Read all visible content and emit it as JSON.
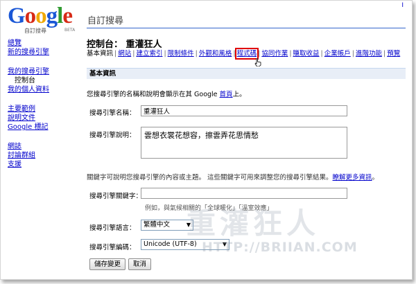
{
  "header": {
    "logo_parts": [
      "G",
      "o",
      "o",
      "g",
      "l",
      "e"
    ],
    "logo_subtitle": "自訂搜尋",
    "logo_beta": "BETA",
    "product_title": "自訂搜尋",
    "top_link": "I"
  },
  "sidebar": {
    "group1": [
      "總覽",
      "新的搜尋引擎"
    ],
    "group2_link": "我的搜尋引擎",
    "group2_current": "控制台",
    "group2_link2": "我的個人資料",
    "group3": [
      "主要範例",
      "說明文件",
      "Google 標記"
    ],
    "group4": [
      "網誌",
      "討論群組",
      "支援"
    ]
  },
  "main": {
    "console_label": "控制台：",
    "engine_name": "重灌狂人",
    "tabs": [
      "基本資訊",
      "網站",
      "建立索引",
      "限制條件",
      "外觀和風格",
      "程式碼",
      "協同作業",
      "賺取收益",
      "企業帳戶",
      "進階功能",
      "預覽"
    ],
    "section_title": "基本資訊",
    "intro_prefix": "您搜尋引擎的名稱和說明會顯示在其 Google ",
    "intro_link": "首頁",
    "intro_suffix": "上。"
  },
  "form": {
    "name_label": "搜尋引擎名稱：",
    "name_value": "重灌狂人",
    "desc_label": "搜尋引擎說明：",
    "desc_value": "雲想衣裳花想容，擦雲弄花思情愁",
    "keywords_intro": "關鍵字可說明您搜尋引擎的內容或主題。 這些關鍵字可用來調整您的搜尋引擎結果。",
    "keywords_learn_more": "瞭解更多資訊",
    "keywords_intro_end": "。",
    "keywords_label": "搜尋引擎關鍵字：",
    "keywords_value": "",
    "keywords_hint": "例如，與氣候相關的「全球暖化」「溫室效應」",
    "language_label": "搜尋引擎語言：",
    "language_value": "繁體中文",
    "encoding_label": "搜尋引擎編碼：",
    "encoding_value": "Unicode (UTF-8)",
    "save_label": "儲存變更",
    "cancel_label": "取消"
  },
  "watermark": {
    "title": "重灌狂人",
    "url": "HTTP://BRIIAN.COM"
  },
  "colors": {
    "link": "#0000cc",
    "section_bg": "#e8eef7",
    "highlight": "#e00000"
  }
}
